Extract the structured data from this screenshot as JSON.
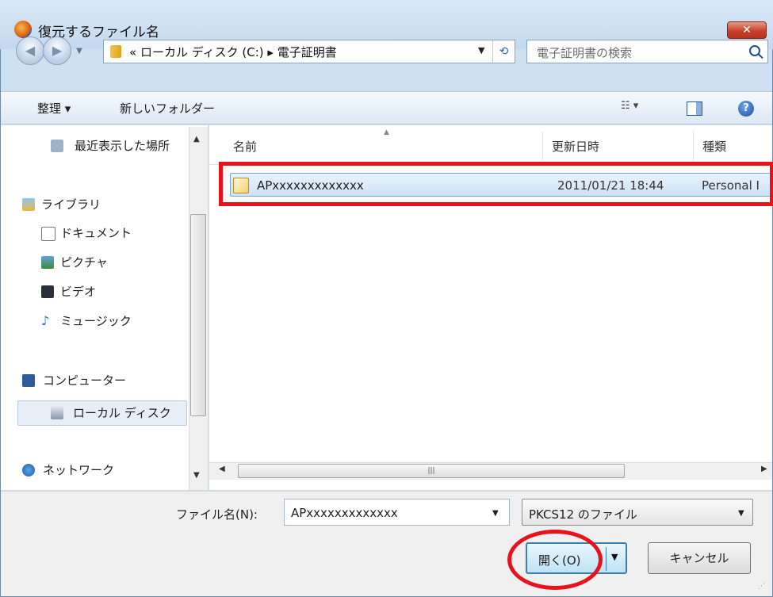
{
  "window": {
    "title": "復元するファイル名",
    "close_label": "✕"
  },
  "address": {
    "path": "« ローカル ディスク (C:) ▸ 電子証明書"
  },
  "search": {
    "placeholder": "電子証明書の検索"
  },
  "toolbar": {
    "organize": "整理 ▾",
    "new_folder": "新しいフォルダー",
    "views": "☷ ▾",
    "help": "?"
  },
  "nav": {
    "items": [
      {
        "label": "最近表示した場所",
        "icon": "recent-places-icon"
      },
      {
        "label": "ライブラリ",
        "icon": "library-icon"
      },
      {
        "label": "ドキュメント",
        "icon": "document-icon"
      },
      {
        "label": "ピクチャ",
        "icon": "picture-icon"
      },
      {
        "label": "ビデオ",
        "icon": "video-icon"
      },
      {
        "label": "ミュージック",
        "icon": "music-icon"
      },
      {
        "label": "コンピューター",
        "icon": "computer-icon"
      },
      {
        "label": "ローカル ディスク",
        "icon": "local-disk-icon"
      },
      {
        "label": "ネットワーク",
        "icon": "network-icon"
      }
    ],
    "selected": "ローカル ディスク"
  },
  "columns": {
    "name": "名前",
    "modified": "更新日時",
    "type": "種類"
  },
  "files": [
    {
      "name": "APxxxxxxxxxxxxx",
      "modified": "2011/01/21 18:44",
      "type": "Personal I"
    }
  ],
  "bottom": {
    "filename_label": "ファイル名(N):",
    "filename_value": "APxxxxxxxxxxxxx",
    "filter_value": "PKCS12 のファイル",
    "open_label": "開く(O)",
    "cancel_label": "キャンセル"
  },
  "colors": {
    "highlight": "#e8121c",
    "selection": "#cfe2f6",
    "accent": "#3c7fb1"
  }
}
